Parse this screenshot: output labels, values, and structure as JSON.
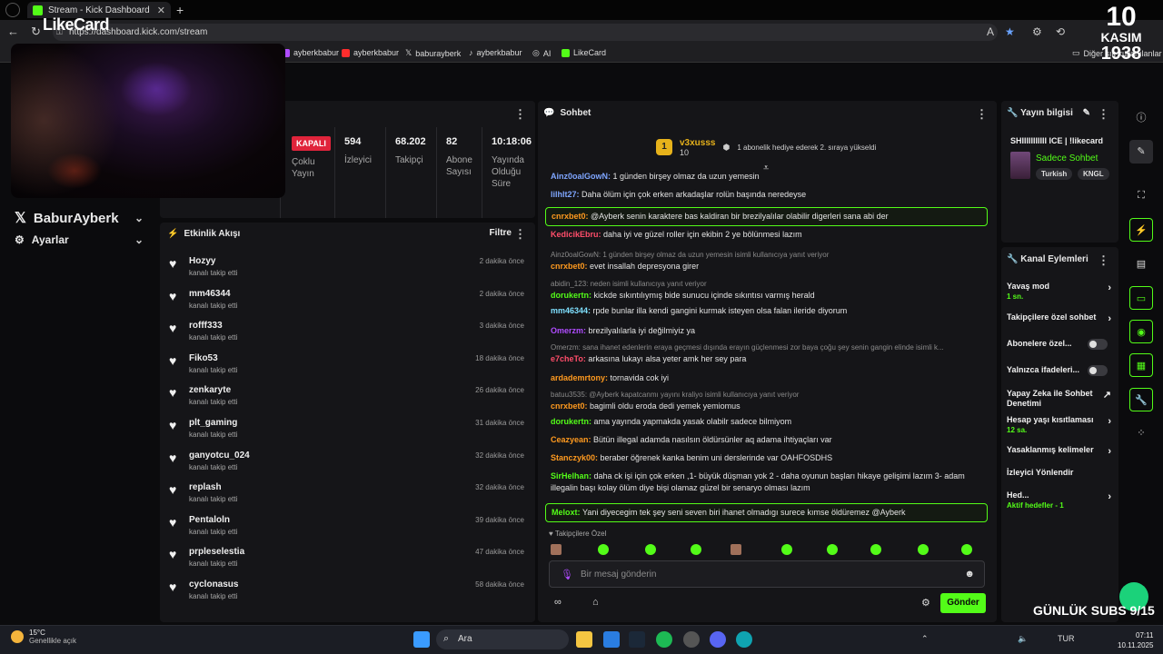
{
  "browser": {
    "tab_title": "Stream - Kick Dashboard",
    "url": "https://dashboard.kick.com/stream",
    "bookmarks": [
      {
        "label": "ayberkbabur",
        "color": "#b04cff"
      },
      {
        "label": "ayberkbabur",
        "color": "#ff2d2d"
      },
      {
        "label": "baburayberk",
        "color": "#dddddd"
      },
      {
        "label": "ayberkbabur",
        "color": "#dddddd"
      },
      {
        "label": "AI",
        "color": "#9a9a9a"
      },
      {
        "label": "LikeCard",
        "color": "#53fc18"
      }
    ],
    "other_favorites": "Diğer sık kullanılanlar"
  },
  "overlay": {
    "likecard": "LikeCard",
    "kasim_day": "10",
    "kasim_month": "KASIM",
    "kasim_year": "1938",
    "daily_subs": "GÜNLÜK SUBS 9/15"
  },
  "sidebar": {
    "user": "BaburAyberk",
    "settings": "Ayarlar"
  },
  "stats": {
    "status": "KAPALI",
    "cells": [
      {
        "value": "",
        "label": "Çoklu Yayın"
      },
      {
        "value": "594",
        "label": "İzleyici"
      },
      {
        "value": "68.202",
        "label": "Takipçi"
      },
      {
        "value": "82",
        "label": "Abone Sayısı"
      },
      {
        "value": "10:18:06",
        "label": "Yayında Olduğu Süre"
      }
    ]
  },
  "activity": {
    "title": "Etkinlik Akışı",
    "filter": "Filtre",
    "items": [
      {
        "name": "Hozyy",
        "sub": "kanalı takip etti",
        "time": "2 dakika önce"
      },
      {
        "name": "mm46344",
        "sub": "kanalı takip etti",
        "time": "2 dakika önce"
      },
      {
        "name": "rofff333",
        "sub": "kanalı takip etti",
        "time": "3 dakika önce"
      },
      {
        "name": "Fiko53",
        "sub": "kanalı takip etti",
        "time": "18 dakika önce"
      },
      {
        "name": "zenkaryte",
        "sub": "kanalı takip etti",
        "time": "26 dakika önce"
      },
      {
        "name": "plt_gaming",
        "sub": "kanalı takip etti",
        "time": "31 dakika önce"
      },
      {
        "name": "ganyotcu_024",
        "sub": "kanalı takip etti",
        "time": "32 dakika önce"
      },
      {
        "name": "replash",
        "sub": "kanalı takip etti",
        "time": "32 dakika önce"
      },
      {
        "name": "Pentaloln",
        "sub": "kanalı takip etti",
        "time": "39 dakika önce"
      },
      {
        "name": "prpleselestia",
        "sub": "kanalı takip etti",
        "time": "47 dakika önce"
      },
      {
        "name": "cyclonasus",
        "sub": "kanalı takip etti",
        "time": "58 dakika önce"
      }
    ]
  },
  "chat": {
    "title": "Sohbet",
    "pinned": {
      "rank": "1",
      "user": "v3xusss",
      "count": "10",
      "message": "1 abonelik hediye ederek 2. sıraya yükseldi"
    },
    "messages": [
      {
        "user": "Ainz0oalGowN",
        "color": "#7fa6ff",
        "text": "1 günden birşey olmaz da uzun yemesin",
        "reply": "",
        "hl": false
      },
      {
        "user": "lilhlt27",
        "color": "#7fa6ff",
        "text": "Daha ölüm için çok erken arkadaşlar rolün başında neredeyse",
        "reply": "",
        "hl": false
      },
      {
        "user": "cnrxbet0",
        "color": "#ff9a1f",
        "text": "@Ayberk senin karaktere bas kaldiran bir brezilyalılar olabilir digerleri sana abi der",
        "reply": "",
        "hl": true
      },
      {
        "user": "KedicikEbru",
        "color": "#ff4d6a",
        "text": "daha iyi ve güzel roller için ekibin 2 ye bölünmesi lazım",
        "reply": "",
        "hl": false
      },
      {
        "user": "cnrxbet0",
        "color": "#ff9a1f",
        "text": "evet insallah depresyona girer",
        "reply": "Ainz0oalGowN: 1 günden birşey olmaz da uzun yemesin isimli kullanıcıya yanıt veriyor",
        "hl": false
      },
      {
        "user": "dorukertn",
        "color": "#53fc18",
        "text": "kickde sıkıntılıymış bide sunucu içinde sıkıntısı varmış herald",
        "reply": "abidin_123: neden isimli kullanıcıya yanıt veriyor",
        "hl": false
      },
      {
        "user": "mm46344",
        "color": "#7fe0ff",
        "text": "rpde bunlar illa kendi gangini kurmak isteyen olsa falan ileride diyorum",
        "reply": "",
        "hl": false
      },
      {
        "user": "Omerzm",
        "color": "#b04cff",
        "text": "brezilyalılarla iyi değilmiyiz ya",
        "reply": "",
        "hl": false
      },
      {
        "user": "e7cheTo",
        "color": "#ff4d6a",
        "text": "arkasına lukayı alsa yeter amk her sey para",
        "reply": "Omerzm: sana ihanet edenlerin eraya geçmesi dışında erayın güçlenmesi zor baya çoğu şey senin gangin elinde isimli k...",
        "hl": false
      },
      {
        "user": "ardademrtony",
        "color": "#ff9a1f",
        "text": "tornavida cok iyi",
        "reply": "",
        "hl": false
      },
      {
        "user": "cnrxbet0",
        "color": "#ff9a1f",
        "text": "bagimli oldu eroda dedi yemek yemiomus",
        "reply": "batuu3535: @Ayberk kapatcanmı yayını kraliyo isimli kullanıcıya yanıt veriyor",
        "hl": false
      },
      {
        "user": "dorukertn",
        "color": "#53fc18",
        "text": "ama yayında yapmakda yasak olabilr sadece bilmiyom",
        "reply": "",
        "hl": false
      },
      {
        "user": "Ceazyean",
        "color": "#ff9a1f",
        "text": "Bütün illegal adamda nasılsın öldürsünler aq adama ihtiyaçları var",
        "reply": "",
        "hl": false
      },
      {
        "user": "Stanczyk00",
        "color": "#ff9a1f",
        "text": "beraber öğrenek kanka benim uni derslerinde var OAHFOSDHS",
        "reply": "",
        "hl": false
      },
      {
        "user": "SirHelhan",
        "color": "#53fc18",
        "text": "daha ck işi için çok erken ,1- büyük düşman yok 2 - daha oyunun başları hikaye gelişimi lazım 3- adam illegalin başı kolay ölüm diye bişi olamaz güzel bir senaryo olması lazım",
        "reply": "",
        "hl": false
      },
      {
        "user": "Meloxt",
        "color": "#53fc18",
        "text": "Yani diyecegim tek şey seni seven biri ihanet olmadıgı surece kımse öldüremez @Ayberk",
        "reply": "",
        "hl": true
      }
    ],
    "followers_only": "Takipçilere Özel",
    "placeholder": "Bir mesaj gönderin",
    "send": "Gönder"
  },
  "stream_info": {
    "title": "Yayın bilgisi",
    "stream_title": "SHIIIIIIIIIII ICE | !likecard",
    "category": "Sadece Sohbet",
    "tags": [
      "Turkish",
      "KNGL"
    ]
  },
  "channel_actions": {
    "title": "Kanal Eylemleri",
    "rows": [
      {
        "label": "Yavaş mod",
        "sub": "1 sn."
      },
      {
        "label": "Takipçilere özel sohbet",
        "sub": ""
      },
      {
        "label": "Abonelere özel...",
        "sub": ""
      },
      {
        "label": "Yalnızca ifadeleri...",
        "sub": ""
      },
      {
        "label": "Yapay Zeka ile Sohbet Denetimi",
        "sub": ""
      },
      {
        "label": "Hesap yaşı kısıtlaması",
        "sub": "12 sa."
      },
      {
        "label": "Yasaklanmış kelimeler",
        "sub": ""
      },
      {
        "label": "İzleyici Yönlendir",
        "sub": ""
      },
      {
        "label": "Hed...",
        "sub": "Aktif hedefler - 1"
      }
    ]
  },
  "taskbar": {
    "temp": "15°C",
    "weather": "Genellikle açık",
    "search": "Ara",
    "lang": "TUR",
    "time": "07:11",
    "date": "10.11.2025"
  }
}
